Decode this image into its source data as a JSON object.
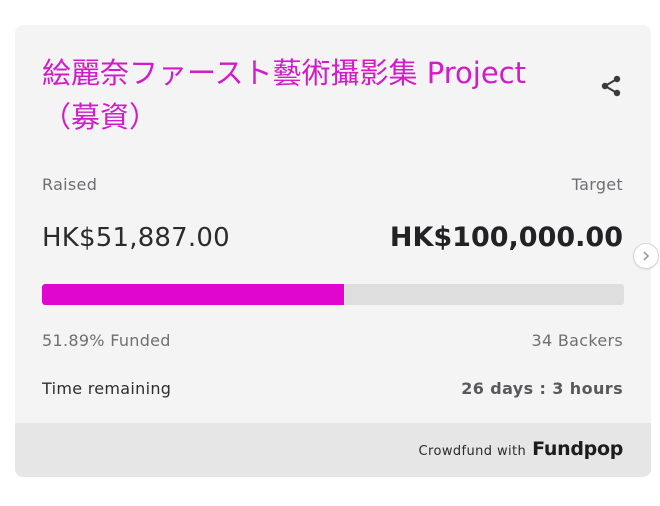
{
  "campaign": {
    "title": "絵麗奈ファースト藝術攝影集 Project（募資）"
  },
  "labels": {
    "raised": "Raised",
    "target": "Target",
    "time_remaining": "Time remaining"
  },
  "amounts": {
    "raised": "HK$51,887.00",
    "target": "HK$100,000.00"
  },
  "progress": {
    "fraction": 0.5189,
    "funded_text": "51.89% Funded",
    "backers_text": "34 Backers"
  },
  "time": {
    "remaining": "26 days : 3 hours"
  },
  "footer": {
    "prefix": "Crowdfund with",
    "brand": "Fundpop"
  },
  "icons": {
    "share": "share-icon",
    "next": "chevron-right-icon"
  },
  "colors": {
    "accent": "#e006cf",
    "title": "#d21bc9",
    "card_bg": "#f4f4f5",
    "track": "#dededf",
    "footer_bg": "#e6e6e7"
  }
}
